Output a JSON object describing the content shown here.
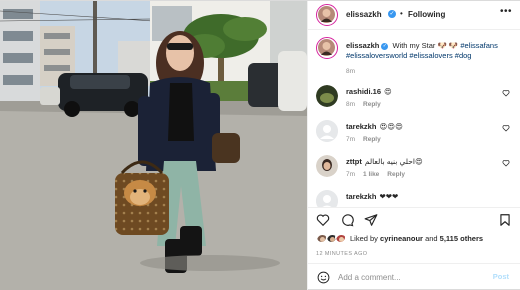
{
  "post": {
    "username": "elissazkh",
    "follow_status": "Following",
    "more_label": "•••",
    "separator": "•",
    "caption": {
      "username": "elissazkh",
      "text": "With my Star",
      "emoji": "🐶 🐶",
      "hashtags": "#elissafans #elissaloversworld #elissalovers #dog"
    },
    "caption_time": "8m",
    "comments": [
      {
        "username": "rashidi.16",
        "text": "😍",
        "time": "8m",
        "reply": "Reply",
        "likes": ""
      },
      {
        "username": "tarekzkh",
        "text": "😍😍😍",
        "time": "7m",
        "reply": "Reply",
        "likes": ""
      },
      {
        "username": "zttpt",
        "text": "احلي بنيه بالعالم😍",
        "time": "7m",
        "likes": "1 like",
        "reply": "Reply"
      },
      {
        "username": "tarekzkh",
        "text": "❤❤❤",
        "time": "",
        "reply": "",
        "likes": ""
      }
    ],
    "likes_prefix": "Liked by",
    "likes_user": "cyrineanour",
    "likes_and": "and",
    "likes_count": "5,115 others",
    "time_ago": "12 MINUTES AGO",
    "add_comment_placeholder": "Add a comment...",
    "post_label": "Post"
  },
  "colors": {
    "accent_blue": "#3897f0",
    "post_disabled": "#b2dffc",
    "muted": "#8e8e8e",
    "text": "#262626",
    "hashtag": "#00376b"
  }
}
